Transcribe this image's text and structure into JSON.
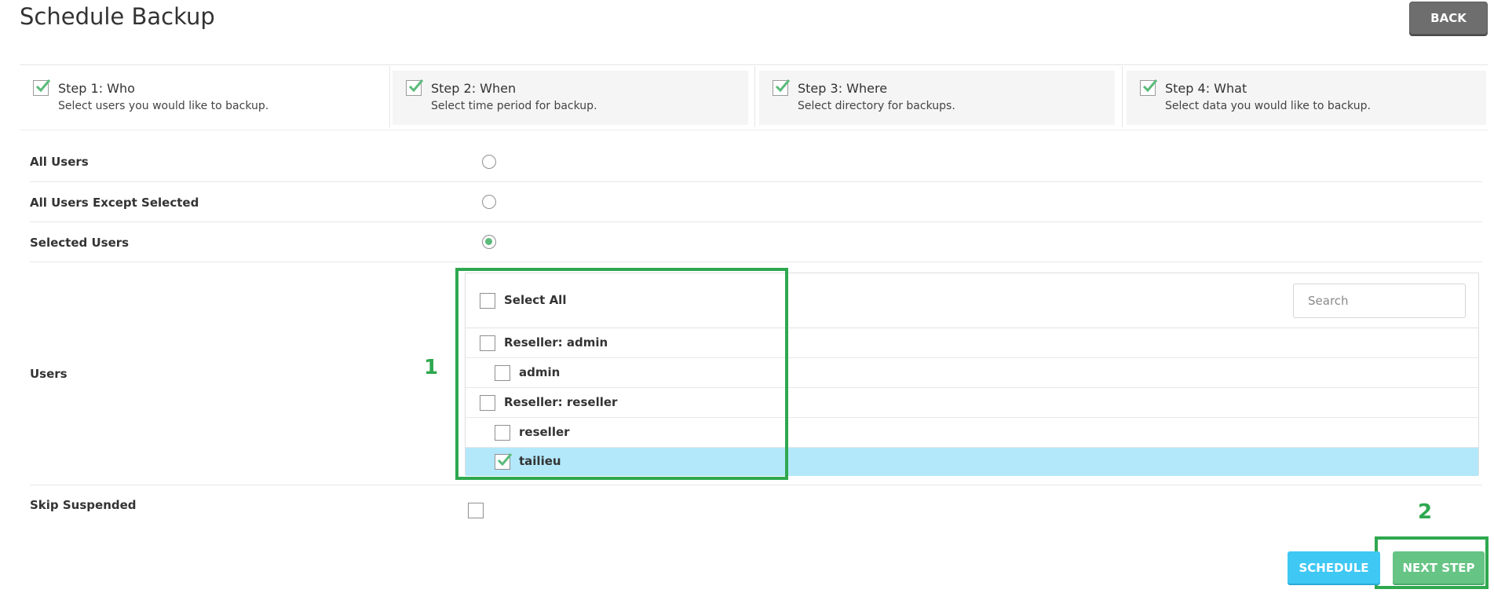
{
  "page": {
    "title": "Schedule Backup",
    "back_label": "BACK"
  },
  "steps": [
    {
      "title": "Step 1: Who",
      "desc": "Select users you would like to backup."
    },
    {
      "title": "Step 2: When",
      "desc": "Select time period for backup."
    },
    {
      "title": "Step 3: Where",
      "desc": "Select directory for backups."
    },
    {
      "title": "Step 4: What",
      "desc": "Select data you would like to backup."
    }
  ],
  "options": {
    "all_users": "All Users",
    "all_except": "All Users Except Selected",
    "selected_users": "Selected Users",
    "selected_value": "Selected Users"
  },
  "users": {
    "label": "Users",
    "select_all": "Select All",
    "search_placeholder": "Search",
    "items": [
      {
        "label": "Reseller: admin",
        "checked": false
      },
      {
        "label": "admin",
        "checked": false
      },
      {
        "label": "Reseller: reseller",
        "checked": false
      },
      {
        "label": "reseller",
        "checked": false
      },
      {
        "label": "tailieu",
        "checked": true
      }
    ]
  },
  "skip_suspended": {
    "label": "Skip Suspended",
    "checked": false
  },
  "actions": {
    "schedule": "SCHEDULE",
    "next_step": "NEXT STEP"
  },
  "annotations": {
    "first": "1",
    "second": "2"
  },
  "colors": {
    "accent_green": "#5bbb7b",
    "selected_row": "#b3e8fb",
    "schedule_blue": "#3fc8f4",
    "annotation_green": "#2ea84f"
  }
}
